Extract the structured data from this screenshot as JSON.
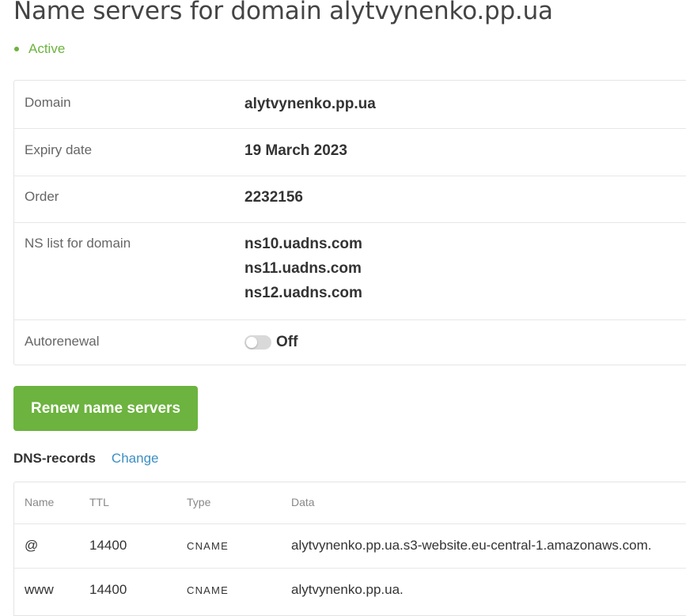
{
  "page": {
    "title": "Name servers for domain alytvynenko.pp.ua",
    "status": "Active"
  },
  "colors": {
    "accent_green": "#6cb33f",
    "link_blue": "#3b8fc4",
    "toggle_off": "#d9d9d9"
  },
  "info": {
    "domain_label": "Domain",
    "domain_value": "alytvynenko.pp.ua",
    "expiry_label": "Expiry date",
    "expiry_value": "19 March 2023",
    "order_label": "Order",
    "order_value": "2232156",
    "ns_label": "NS list for domain",
    "ns_list": [
      "ns10.uadns.com",
      "ns11.uadns.com",
      "ns12.uadns.com"
    ],
    "autorenewal_label": "Autorenewal",
    "autorenewal_state": "Off"
  },
  "actions": {
    "renew_label": "Renew name servers"
  },
  "dns": {
    "title": "DNS-records",
    "change_label": "Change",
    "columns": [
      "Name",
      "TTL",
      "Type",
      "Data"
    ],
    "records": [
      {
        "name": "@",
        "ttl": "14400",
        "type": "CNAME",
        "data": "alytvynenko.pp.ua.s3-website.eu-central-1.amazonaws.com."
      },
      {
        "name": "www",
        "ttl": "14400",
        "type": "CNAME",
        "data": "alytvynenko.pp.ua."
      }
    ]
  }
}
